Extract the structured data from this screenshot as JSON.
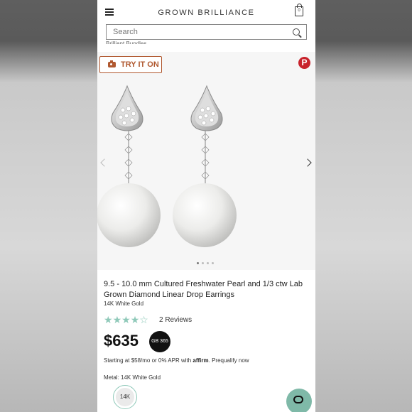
{
  "header": {
    "brand": "GROWN BRILLIANCE",
    "cart_count": "0"
  },
  "search": {
    "placeholder": "Search"
  },
  "cut_text": "Brilliant Bundles",
  "gallery": {
    "try_on_label": "TRY IT ON",
    "pin_label": "P",
    "active_slide": 1,
    "slide_count": 4
  },
  "product": {
    "title": "9.5 - 10.0 mm Cultured Freshwater Pearl and 1/3 ctw Lab Grown Diamond Linear Drop Earrings",
    "metal_subtitle": "14K White Gold",
    "rating": 4,
    "rating_max": 5,
    "reviews": "2 Reviews",
    "price": "$635",
    "badge": "GB 365",
    "financing_prefix": "Starting at $58/mo or 0% APR with ",
    "financing_brand": "affirm",
    "financing_suffix": ". Prequalify now",
    "metal_label": "Metal: 14K White Gold",
    "swatch_label": "14K"
  },
  "colors": {
    "accent": "#b0582f",
    "star": "#8fc9b9",
    "chat": "#7fb9a8",
    "pinterest": "#c8232c"
  }
}
